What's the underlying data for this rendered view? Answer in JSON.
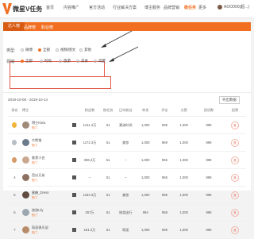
{
  "nav": {
    "logo_text": "微星V任务",
    "items": [
      "首页",
      "内容推广",
      "官方活动",
      "行业解决方案",
      "博主服务",
      "品牌营销",
      "微任务",
      "更多"
    ],
    "active_index": 6,
    "user": "AOO000(超...)"
  },
  "tabs": [
    "达人榜",
    "品牌榜",
    "职业榜"
  ],
  "filters": {
    "type_label": "类型:",
    "type_options": [
      "微博",
      "全部",
      "视频/图文",
      "其他"
    ],
    "type_selected": 1,
    "area_label": "领域:",
    "area_options": [
      "全部",
      "时尚",
      "旅游",
      "美食",
      "母婴"
    ],
    "area_selected": 0
  },
  "date_range": "2019-10-08 - 2019-10-14",
  "export_label": "导出数据",
  "table": {
    "headers": [
      "排名",
      "博主",
      "",
      "粉丝数",
      "微任务",
      "日均粉丝",
      "转发",
      "评论",
      "点赞",
      "阅读数",
      "投票"
    ],
    "rows": [
      {
        "rank": "1",
        "name": "博主Kiwa",
        "sub": "热门",
        "fans": "1211.2万",
        "task": "51",
        "cat": "潮流时尚",
        "r": "1,000",
        "c": "998",
        "l": "1,000",
        "reads": "999",
        "vote": "投"
      },
      {
        "rank": "2",
        "name": "大熊猫",
        "sub": "热门",
        "fans": "1172.3万",
        "task": "51",
        "cat": "美妆",
        "r": "1,000",
        "c": "969",
        "l": "1,000",
        "reads": "999",
        "vote": "投"
      },
      {
        "rank": "3",
        "name": "美食小白",
        "sub": "热门",
        "fans": "396.2万",
        "task": "51",
        "cat": "--",
        "r": "1,000",
        "c": "965",
        "l": "1,000",
        "reads": "999",
        "vote": "投"
      },
      {
        "rank": "4",
        "name": "西瓜兄弟",
        "sub": "热门",
        "fans": "--",
        "task": "51",
        "cat": "--",
        "r": "1,000",
        "c": "965",
        "l": "1,000",
        "reads": "999",
        "vote": "投"
      },
      {
        "rank": "5",
        "name": "蜜糖_Dress",
        "sub": "热门",
        "fans": "1153.3万",
        "task": "51",
        "cat": "美妆",
        "r": "1,000",
        "c": "998",
        "l": "1,000",
        "reads": "998",
        "vote": "投"
      },
      {
        "rank": "6",
        "name": "旅游Lily",
        "sub": "热门",
        "fans": "267万",
        "task": "51",
        "cat": "旅游出行",
        "r": "994",
        "c": "958",
        "l": "1,000",
        "reads": "998",
        "vote": "投"
      },
      {
        "rank": "7",
        "name": "萌宠俱乐部",
        "sub": "热门",
        "fans": "181.2万",
        "task": "51",
        "cat": "萌宠",
        "r": "1,000",
        "c": "998",
        "l": "1,000",
        "reads": "999",
        "vote": "投"
      }
    ]
  }
}
